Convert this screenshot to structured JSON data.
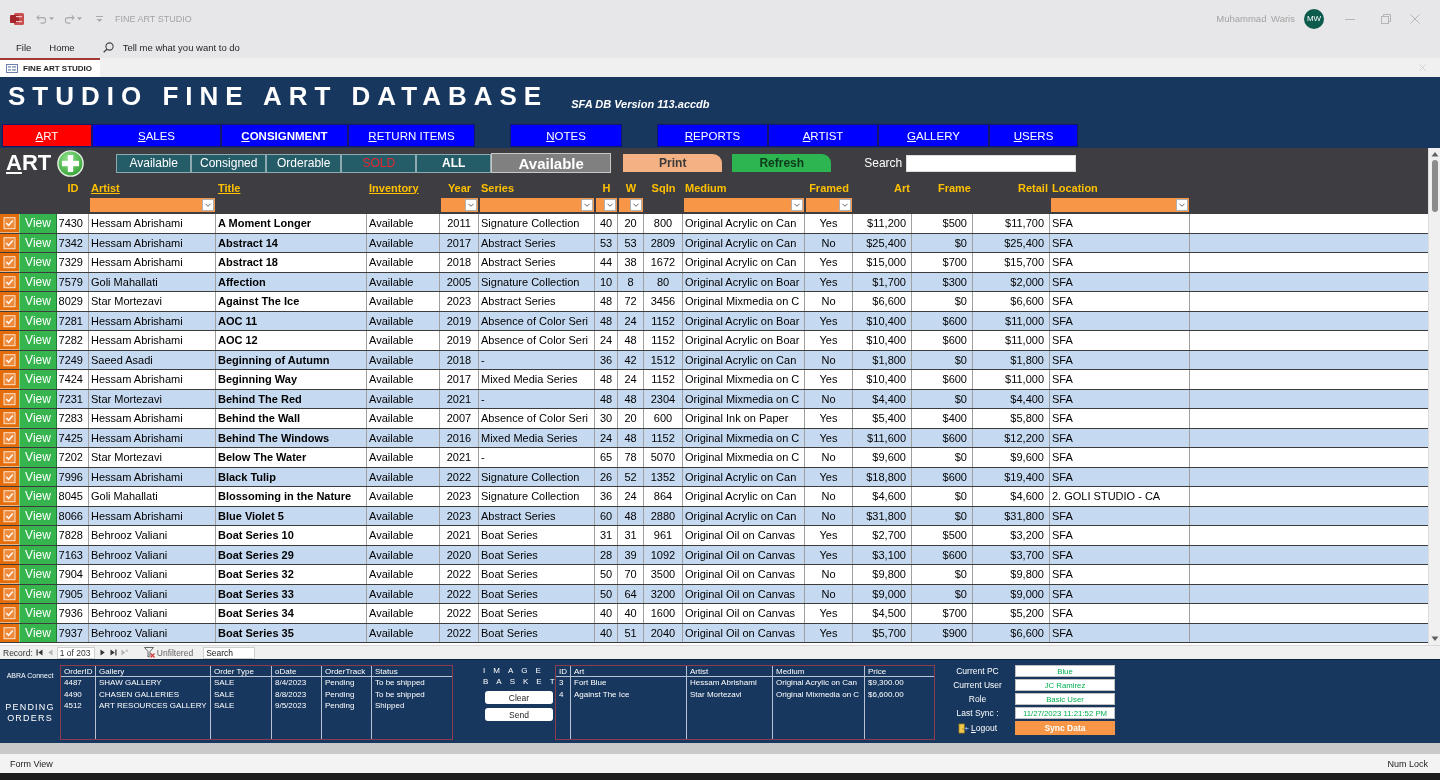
{
  "window": {
    "title": "FINE ART STUDIO",
    "user": "Muhammad Waris",
    "avatar": "MW"
  },
  "ribbon": {
    "menus": [
      "File",
      "Home"
    ],
    "tell_me": {
      "placeholder": "Tell me what you want to do"
    }
  },
  "document_tabs": [
    {
      "label": "FINE ART STUDIO",
      "selected": true
    }
  ],
  "header": {
    "title": "STUDIO FINE ART DATABASE",
    "version": "SFA DB Version 113.accdb"
  },
  "nav_groups": [
    {
      "buttons": [
        {
          "label": "ART",
          "selected": true,
          "bold": false
        },
        {
          "label": "SALES",
          "selected": false,
          "bold": false
        },
        {
          "label": "CONSIGNMENT",
          "selected": false,
          "bold": true
        },
        {
          "label": "RETURN ITEMS",
          "selected": false,
          "bold": false
        }
      ]
    },
    {
      "buttons": [
        {
          "label": "NOTES",
          "selected": false,
          "bold": false
        }
      ]
    },
    {
      "buttons": [
        {
          "label": "REPORTS",
          "selected": false,
          "bold": false
        },
        {
          "label": "ARTIST",
          "selected": false,
          "bold": false
        },
        {
          "label": "GALLERY",
          "selected": false,
          "bold": false
        },
        {
          "label": "USERS",
          "selected": false,
          "bold": false
        }
      ]
    }
  ],
  "toolbar": {
    "section": "ART",
    "filters": [
      {
        "label": "Available",
        "kind": "normal"
      },
      {
        "label": "Consigned",
        "kind": "normal"
      },
      {
        "label": "Orderable",
        "kind": "normal"
      },
      {
        "label": "SOLD",
        "kind": "warning"
      },
      {
        "label": "ALL",
        "kind": "strong"
      }
    ],
    "current_filter": "Available",
    "actions": [
      {
        "kind": "print",
        "label": "Print"
      },
      {
        "kind": "refresh",
        "label": "Refresh"
      }
    ],
    "search": {
      "label": "Search"
    }
  },
  "table": {
    "columns": [
      {
        "label": "ID",
        "underlined": false,
        "filter": false
      },
      {
        "label": "Artist",
        "underlined": true,
        "filter": true
      },
      {
        "label": "Title",
        "underlined": true,
        "filter": false
      },
      {
        "label": "Inventory",
        "underlined": true,
        "filter": false
      },
      {
        "label": "Year",
        "underlined": false,
        "filter": true
      },
      {
        "label": "Series",
        "underlined": false,
        "filter": true
      },
      {
        "label": "H",
        "underlined": false,
        "filter": true
      },
      {
        "label": "W",
        "underlined": false,
        "filter": true
      },
      {
        "label": "SqIn",
        "underlined": false,
        "filter": false
      },
      {
        "label": "Medium",
        "underlined": false,
        "filter": true
      },
      {
        "label": "Framed",
        "underlined": false,
        "filter": true
      },
      {
        "label": "Art",
        "underlined": false,
        "filter": false
      },
      {
        "label": "Frame",
        "underlined": false,
        "filter": false
      },
      {
        "label": "Retail",
        "underlined": false,
        "filter": false
      },
      {
        "label": "Location",
        "underlined": false,
        "filter": true
      }
    ],
    "rows": [
      {
        "checked": true,
        "action": "View",
        "cells": [
          "7430",
          "Hessam Abrishami",
          "A Moment Longer",
          "Available",
          "2011",
          "Signature Collection",
          "40",
          "20",
          "800",
          "Original Acrylic on Can",
          "Yes",
          "$11,200",
          "$500",
          "$11,700",
          "SFA"
        ]
      },
      {
        "checked": true,
        "action": "View",
        "cells": [
          "7342",
          "Hessam Abrishami",
          "Abstract 14",
          "Available",
          "2017",
          "Abstract Series",
          "53",
          "53",
          "2809",
          "Original Acrylic on Can",
          "No",
          "$25,400",
          "$0",
          "$25,400",
          "SFA"
        ]
      },
      {
        "checked": true,
        "action": "View",
        "cells": [
          "7329",
          "Hessam Abrishami",
          "Abstract 18",
          "Available",
          "2018",
          "Abstract Series",
          "44",
          "38",
          "1672",
          "Original Acrylic on Can",
          "Yes",
          "$15,000",
          "$700",
          "$15,700",
          "SFA"
        ]
      },
      {
        "checked": true,
        "action": "View",
        "cells": [
          "7579",
          "Goli Mahallati",
          "Affection",
          "Available",
          "2005",
          "Signature Collection",
          "10",
          "8",
          "80",
          "Original Acrylic on Boar",
          "Yes",
          "$1,700",
          "$300",
          "$2,000",
          "SFA"
        ]
      },
      {
        "checked": true,
        "action": "View",
        "cells": [
          "8029",
          "Star Mortezavi",
          "Against The Ice",
          "Available",
          "2023",
          "Abstract Series",
          "48",
          "72",
          "3456",
          "Original Mixmedia on C",
          "No",
          "$6,600",
          "$0",
          "$6,600",
          "SFA"
        ]
      },
      {
        "checked": true,
        "action": "View",
        "cells": [
          "7281",
          "Hessam Abrishami",
          "AOC 11",
          "Available",
          "2019",
          "Absence of Color Seri",
          "48",
          "24",
          "1152",
          "Original Acrylic on Boar",
          "Yes",
          "$10,400",
          "$600",
          "$11,000",
          "SFA"
        ]
      },
      {
        "checked": true,
        "action": "View",
        "cells": [
          "7282",
          "Hessam Abrishami",
          "AOC 12",
          "Available",
          "2019",
          "Absence of Color Seri",
          "24",
          "48",
          "1152",
          "Original Acrylic on Boar",
          "Yes",
          "$10,400",
          "$600",
          "$11,000",
          "SFA"
        ]
      },
      {
        "checked": true,
        "action": "View",
        "cells": [
          "7249",
          "Saeed Asadi",
          "Beginning of Autumn",
          "Available",
          "2018",
          "-",
          "36",
          "42",
          "1512",
          "Original Acrylic on Can",
          "No",
          "$1,800",
          "$0",
          "$1,800",
          "SFA"
        ]
      },
      {
        "checked": true,
        "action": "View",
        "cells": [
          "7424",
          "Hessam Abrishami",
          "Beginning Way",
          "Available",
          "2017",
          "Mixed Media Series",
          "48",
          "24",
          "1152",
          "Original Mixmedia on C",
          "Yes",
          "$10,400",
          "$600",
          "$11,000",
          "SFA"
        ]
      },
      {
        "checked": true,
        "action": "View",
        "cells": [
          "7231",
          "Star Mortezavi",
          "Behind The Red",
          "Available",
          "2021",
          "-",
          "48",
          "48",
          "2304",
          "Original Mixmedia on C",
          "No",
          "$4,400",
          "$0",
          "$4,400",
          "SFA"
        ]
      },
      {
        "checked": true,
        "action": "View",
        "cells": [
          "7283",
          "Hessam Abrishami",
          "Behind the Wall",
          "Available",
          "2007",
          "Absence of Color Seri",
          "30",
          "20",
          "600",
          "Original Ink on Paper",
          "Yes",
          "$5,400",
          "$400",
          "$5,800",
          "SFA"
        ]
      },
      {
        "checked": true,
        "action": "View",
        "cells": [
          "7425",
          "Hessam Abrishami",
          "Behind The Windows",
          "Available",
          "2016",
          "Mixed Media Series",
          "24",
          "48",
          "1152",
          "Original Mixmedia on C",
          "Yes",
          "$11,600",
          "$600",
          "$12,200",
          "SFA"
        ]
      },
      {
        "checked": true,
        "action": "View",
        "cells": [
          "7202",
          "Star Mortezavi",
          "Below The Water",
          "Available",
          "2021",
          "-",
          "65",
          "78",
          "5070",
          "Original Mixmedia on C",
          "No",
          "$9,600",
          "$0",
          "$9,600",
          "SFA"
        ]
      },
      {
        "checked": true,
        "action": "View",
        "cells": [
          "7996",
          "Hessam Abrishami",
          "Black Tulip",
          "Available",
          "2022",
          "Signature Collection",
          "26",
          "52",
          "1352",
          "Original Acrylic on Can",
          "Yes",
          "$18,800",
          "$600",
          "$19,400",
          "SFA"
        ]
      },
      {
        "checked": true,
        "action": "View",
        "cells": [
          "8045",
          "Goli Mahallati",
          "Blossoming in the Nature",
          "Available",
          "2023",
          "Signature Collection",
          "36",
          "24",
          "864",
          "Original Acrylic on Can",
          "No",
          "$4,600",
          "$0",
          "$4,600",
          "2. GOLI STUDIO - CA"
        ]
      },
      {
        "checked": true,
        "action": "View",
        "cells": [
          "8066",
          "Hessam Abrishami",
          "Blue Violet 5",
          "Available",
          "2023",
          "Abstract Series",
          "60",
          "48",
          "2880",
          "Original Acrylic on Can",
          "No",
          "$31,800",
          "$0",
          "$31,800",
          "SFA"
        ]
      },
      {
        "checked": true,
        "action": "View",
        "cells": [
          "7828",
          "Behrooz Valiani",
          "Boat Series 10",
          "Available",
          "2021",
          "Boat Series",
          "31",
          "31",
          "961",
          "Original Oil on Canvas",
          "Yes",
          "$2,700",
          "$500",
          "$3,200",
          "SFA"
        ]
      },
      {
        "checked": true,
        "action": "View",
        "cells": [
          "7163",
          "Behrooz Valiani",
          "Boat Series 29",
          "Available",
          "2020",
          "Boat Series",
          "28",
          "39",
          "1092",
          "Original Oil on Canvas",
          "Yes",
          "$3,100",
          "$600",
          "$3,700",
          "SFA"
        ]
      },
      {
        "checked": true,
        "action": "View",
        "cells": [
          "7904",
          "Behrooz Valiani",
          "Boat Series 32",
          "Available",
          "2022",
          "Boat Series",
          "50",
          "70",
          "3500",
          "Original Oil on Canvas",
          "No",
          "$9,800",
          "$0",
          "$9,800",
          "SFA"
        ]
      },
      {
        "checked": true,
        "action": "View",
        "cells": [
          "7905",
          "Behrooz Valiani",
          "Boat Series 33",
          "Available",
          "2022",
          "Boat Series",
          "50",
          "64",
          "3200",
          "Original Oil on Canvas",
          "No",
          "$9,000",
          "$0",
          "$9,000",
          "SFA"
        ]
      },
      {
        "checked": true,
        "action": "View",
        "cells": [
          "7936",
          "Behrooz Valiani",
          "Boat Series 34",
          "Available",
          "2022",
          "Boat Series",
          "40",
          "40",
          "1600",
          "Original Oil on Canvas",
          "Yes",
          "$4,500",
          "$700",
          "$5,200",
          "SFA"
        ]
      },
      {
        "checked": true,
        "action": "View",
        "cells": [
          "7937",
          "Behrooz Valiani",
          "Boat Series 35",
          "Available",
          "2022",
          "Boat Series",
          "40",
          "51",
          "2040",
          "Original Oil on Canvas",
          "Yes",
          "$5,700",
          "$900",
          "$6,600",
          "SFA"
        ]
      }
    ]
  },
  "record_nav": {
    "label": "Record:",
    "position": "1 of 203",
    "filter_state": "Unfiltered",
    "search": {
      "placeholder": "Search"
    }
  },
  "pending_orders": {
    "brand": "ABRA Connect",
    "title": "PENDING ORDERS",
    "columns": [
      "OrderID",
      "Gallery",
      "Order Type",
      "oDate",
      "OrderTrack",
      "Status"
    ],
    "rows": [
      [
        "4487",
        "SHAW GALLERY",
        "SALE",
        "8/4/2023",
        "Pending",
        "To be shipped"
      ],
      [
        "4490",
        "CHASEN GALLERIES",
        "SALE",
        "8/8/2023",
        "Pending",
        "To be shipped"
      ],
      [
        "4512",
        "ART RESOURCES GALLERY",
        "SALE",
        "9/5/2023",
        "Pending",
        "Shipped"
      ]
    ]
  },
  "image_basket": {
    "title": "IMAGE BASKET",
    "buttons": [
      "Clear",
      "Send"
    ],
    "columns": [
      "ID",
      "Art",
      "Artist",
      "Medium",
      "Price"
    ],
    "rows": [
      [
        "3",
        "Fort Blue",
        "Hessam Abrishami",
        "Original Acrylic on Can",
        "$9,300.00"
      ],
      [
        "4",
        "Against The Ice",
        "Star Mortezavi",
        "Original Mixmedia on C",
        "$6,600.00"
      ]
    ]
  },
  "session": {
    "fields": [
      {
        "label": "Current PC",
        "value": "Blue"
      },
      {
        "label": "Current User",
        "value": "JC Ramirez"
      },
      {
        "label": "Role",
        "value": "Basic User"
      },
      {
        "label": "Last Sync :",
        "value": "11/27/2023 11:21:52 PM"
      }
    ],
    "logout": "Logout",
    "sync": "Sync Data"
  },
  "status_bar": {
    "view": "Form View",
    "indicators": [
      "Num Lock"
    ]
  }
}
